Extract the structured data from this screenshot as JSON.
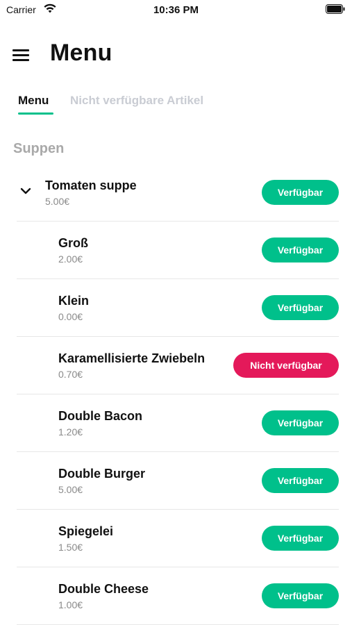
{
  "status_bar": {
    "carrier": "Carrier",
    "time": "10:36 PM"
  },
  "header": {
    "title": "Menu"
  },
  "tabs": [
    {
      "label": "Menu",
      "active": true
    },
    {
      "label": "Nicht verfügbare Artikel",
      "active": false
    }
  ],
  "section": {
    "title": "Suppen"
  },
  "colors": {
    "accent": "#00c08b",
    "unavailable": "#e4195a",
    "inactive_tab": "#c9ccd3"
  },
  "items": [
    {
      "name": "Tomaten suppe",
      "price": "5.00€",
      "status": "Verfügbar"
    },
    {
      "name": "Groß",
      "price": "2.00€",
      "status": "Verfügbar"
    },
    {
      "name": "Klein",
      "price": "0.00€",
      "status": "Verfügbar"
    },
    {
      "name": "Karamellisierte Zwiebeln",
      "price": "0.70€",
      "status": "Nicht verfügbar"
    },
    {
      "name": "Double Bacon",
      "price": "1.20€",
      "status": "Verfügbar"
    },
    {
      "name": "Double Burger",
      "price": "5.00€",
      "status": "Verfügbar"
    },
    {
      "name": "Spiegelei",
      "price": "1.50€",
      "status": "Verfügbar"
    },
    {
      "name": "Double Cheese",
      "price": "1.00€",
      "status": "Verfügbar"
    }
  ]
}
